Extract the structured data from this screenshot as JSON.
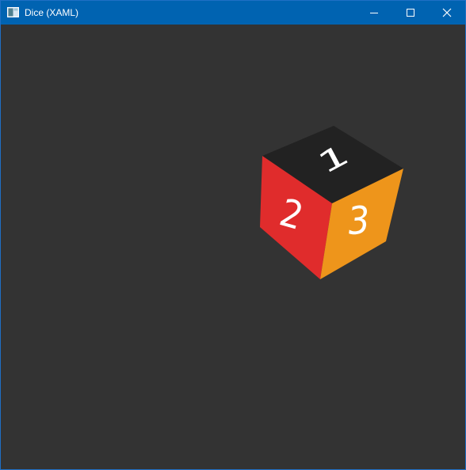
{
  "window": {
    "title": "Dice (XAML)",
    "icon": "app-window-icon"
  },
  "controls": {
    "minimize_icon": "minimize-icon",
    "maximize_icon": "maximize-icon",
    "close_icon": "close-icon"
  },
  "colors": {
    "titlebar": "#0063b1",
    "background": "#333333",
    "top_face": "#222222",
    "left_face": "#e02c2c",
    "right_face": "#ee951b",
    "pips_text": "#ffffff"
  },
  "dice": {
    "top_face_number": "1",
    "left_face_number": "2",
    "right_face_number": "3"
  }
}
